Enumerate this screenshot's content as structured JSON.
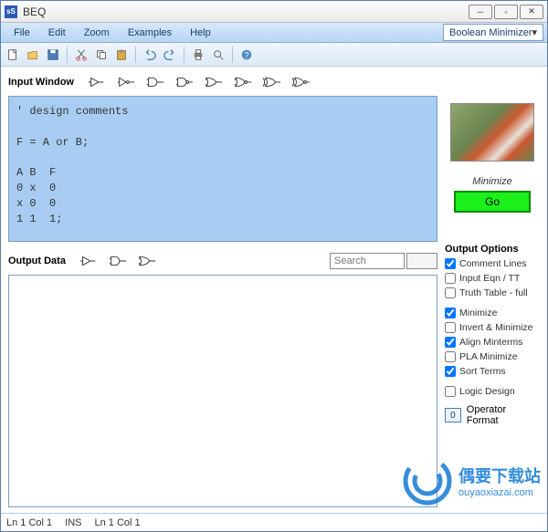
{
  "window": {
    "title": "BEQ",
    "icon": "sS"
  },
  "menubar": [
    "File",
    "Edit",
    "Zoom",
    "Examples",
    "Help"
  ],
  "mode": "Boolean Minimizer",
  "toolbar_icons": [
    "new",
    "open",
    "save",
    "cut",
    "copy",
    "paste",
    "undo",
    "redo",
    "print",
    "preview",
    "help"
  ],
  "input": {
    "title": "Input Window",
    "gates": [
      "buffer",
      "not",
      "and",
      "nand",
      "or",
      "nor",
      "xor",
      "xnor"
    ],
    "content": "' design comments\n\nF = A or B;\n\nA B  F\n0 x  0\nx 0  0\n1 1  1;"
  },
  "output": {
    "title": "Output Data",
    "gates": [
      "buffer",
      "and",
      "or"
    ],
    "search_placeholder": "Search"
  },
  "minimize": {
    "label": "Minimize",
    "button": "Go"
  },
  "options": {
    "title": "Output Options",
    "items": [
      {
        "label": "Comment Lines",
        "checked": true
      },
      {
        "label": "Input Eqn / TT",
        "checked": false
      },
      {
        "label": "Truth Table - full",
        "checked": false
      },
      {
        "label": "Minimize",
        "checked": true,
        "gap": true
      },
      {
        "label": "Invert & Minimize",
        "checked": false
      },
      {
        "label": "Align Minterms",
        "checked": true
      },
      {
        "label": "PLA Minimize",
        "checked": false
      },
      {
        "label": "Sort Terms",
        "checked": true
      },
      {
        "label": "Logic Design",
        "checked": false,
        "gap": true
      }
    ],
    "op_format": {
      "value": "0",
      "label": "Operator Format"
    }
  },
  "statusbar": {
    "pos": "Ln 1  Col 1",
    "ins": "INS",
    "pos2": "Ln 1  Col 1"
  },
  "watermark": {
    "cn": "偶要下载站",
    "url": "ouyaoxiazai.com"
  }
}
